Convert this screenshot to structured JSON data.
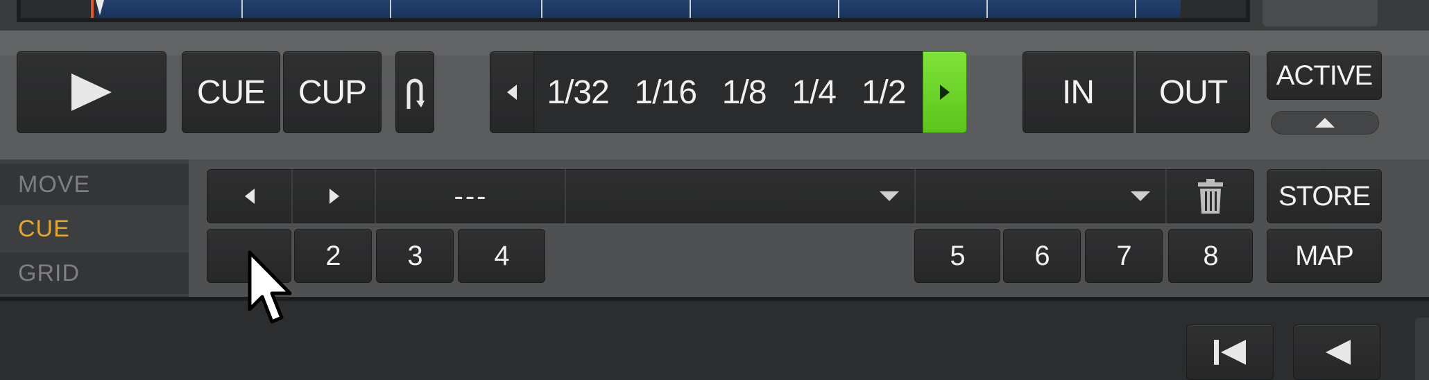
{
  "transport": {
    "play_icon": "play-icon",
    "cue_label": "CUE",
    "cup_label": "CUP",
    "loop_toggle_icon": "loop-icon"
  },
  "beatjump": {
    "prev_icon": "chevron-left-icon",
    "values": [
      "1/32",
      "1/16",
      "1/8",
      "1/4",
      "1/2"
    ],
    "next_icon": "chevron-right-icon",
    "active_color": "#6fd62a"
  },
  "loop": {
    "in_label": "IN",
    "out_label": "OUT"
  },
  "active": {
    "label": "ACTIVE",
    "expand_icon": "chevron-up-icon"
  },
  "mode_tabs": [
    {
      "label": "MOVE",
      "selected": false
    },
    {
      "label": "CUE",
      "selected": true
    },
    {
      "label": "GRID",
      "selected": false
    }
  ],
  "cue_panel": {
    "cue_name": "---",
    "store_label": "STORE",
    "map_label": "MAP",
    "hotcues": [
      "",
      "2",
      "3",
      "4",
      "5",
      "6",
      "7",
      "8"
    ],
    "delete_icon": "trash-icon"
  },
  "colors": {
    "selected_tab": "#e2a53a",
    "playhead": "#d9582e",
    "waveform": "#1d3a66"
  }
}
